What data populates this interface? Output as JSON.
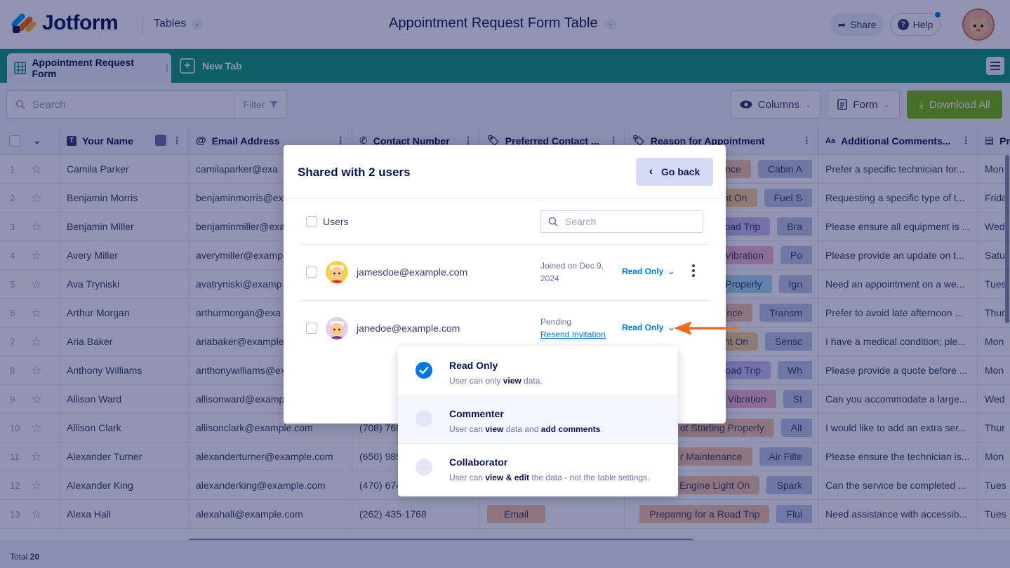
{
  "header": {
    "logo_text": "Jotform",
    "tables_label": "Tables",
    "page_title": "Appointment Request Form Table",
    "share_label": "Share",
    "help_label": "Help"
  },
  "tabs": {
    "active_label": "Appointment Request Form",
    "new_tab_label": "New Tab"
  },
  "toolbar": {
    "search_placeholder": "Search",
    "filter_label": "Filter",
    "columns_label": "Columns",
    "form_label": "Form",
    "download_label": "Download All"
  },
  "table": {
    "headers": [
      "Your Name",
      "Email Address",
      "Contact Number",
      "Preferred Contact ...",
      "Reason for Appointment",
      "Additional Comments...",
      "Pr"
    ],
    "rows": [
      {
        "n": "1",
        "name": "Camila Parker",
        "email": "camilaparker@exa",
        "contact": "",
        "pref": "",
        "reason1": "nce",
        "reason2": "Cabin A",
        "comment": "Prefer a specific technician for...",
        "day": "Mon"
      },
      {
        "n": "2",
        "name": "Benjamin Morris",
        "email": "benjaminmorris@ex",
        "contact": "",
        "pref": "",
        "reason1": "ht On",
        "reason2": "Fuel S",
        "comment": "Requesting a specific type of t...",
        "day": "Frida"
      },
      {
        "n": "3",
        "name": "Benjamin Miller",
        "email": "benjaminmiller@exa",
        "contact": "",
        "pref": "",
        "reason1": "oad Trip",
        "reason2": "Bra",
        "comment": "Please ensure all equipment is ...",
        "day": "Wed"
      },
      {
        "n": "4",
        "name": "Avery Miller",
        "email": "averymiller@example",
        "contact": "",
        "pref": "",
        "reason1": "Vibration",
        "reason2": "Po",
        "comment": "Please provide an update on t...",
        "day": "Satu"
      },
      {
        "n": "5",
        "name": "Ava Tryniski",
        "email": "avatryniski@examp",
        "contact": "",
        "pref": "",
        "reason1": "Properly",
        "reason2": "Ign",
        "comment": "Need an appointment on a we...",
        "day": "Tues"
      },
      {
        "n": "6",
        "name": "Arthur Morgan",
        "email": "arthurmorgan@exa",
        "contact": "",
        "pref": "",
        "reason1": "nce",
        "reason2": "Transm",
        "comment": "Prefer to avoid late afternoon ...",
        "day": "Thur"
      },
      {
        "n": "7",
        "name": "Aria Baker",
        "email": "ariabaker@example.",
        "contact": "",
        "pref": "",
        "reason1": "ht On",
        "reason2": "Sensc",
        "comment": "I have a medical condition; ple...",
        "day": "Mon"
      },
      {
        "n": "8",
        "name": "Anthony Williams",
        "email": "anthonywilliams@ex",
        "contact": "",
        "pref": "",
        "reason1": "oad Trip",
        "reason2": "Wh",
        "comment": "Please provide a quote before ...",
        "day": "Mon"
      },
      {
        "n": "9",
        "name": "Allison Ward",
        "email": "allisonward@examp",
        "contact": "",
        "pref": "",
        "reason1": "Vibration",
        "reason2": "St",
        "comment": "Can you accommodate a large...",
        "day": "Wed"
      },
      {
        "n": "10",
        "name": "Allison Clark",
        "email": "allisonclark@example.com",
        "contact": "(708) 768",
        "pref": "",
        "reason1": "ot Starting Properly",
        "reason2": "Alt",
        "comment": "I would like to add an extra ser...",
        "day": "Thur"
      },
      {
        "n": "11",
        "name": "Alexander Turner",
        "email": "alexanderturner@example.com",
        "contact": "(650) 985",
        "pref": "",
        "reason1": "r Maintenance",
        "reason2": "Air Filte",
        "comment": "Please ensure the technician is...",
        "day": "Mon"
      },
      {
        "n": "12",
        "name": "Alexander King",
        "email": "alexanderking@example.com",
        "contact": "(470) 674",
        "pref": "",
        "reason1": "Engine Light On",
        "reason2": "Spark",
        "comment": "Can the service be completed ...",
        "day": "Tues"
      },
      {
        "n": "13",
        "name": "Alexa Hall",
        "email": "alexahall@example.com",
        "contact": "(262) 435-1768",
        "pref": "Email",
        "reason1": "Preparing for a Road Trip",
        "reason2": "Flui",
        "comment": "Need assistance with accessib...",
        "day": "Tues"
      }
    ],
    "total_label": "Total",
    "total_value": "20"
  },
  "modal": {
    "title": "Shared with 2 users",
    "go_back_label": "Go back",
    "users_label": "Users",
    "search_placeholder": "Search",
    "users": [
      {
        "email": "jamesdoe@example.com",
        "status_line1": "Joined on Dec 9,",
        "status_line2": "2024",
        "role": "Read Only"
      },
      {
        "email": "janedoe@example.com",
        "status_line1": "Pending",
        "status_link": "Resend Invitation",
        "role": "Read Only"
      }
    ]
  },
  "role_dropdown": {
    "options": [
      {
        "title": "Read Only",
        "desc_pre": "User can only ",
        "desc_b1": "view",
        "desc_mid": " data.",
        "desc_b2": "",
        "desc_post": "",
        "selected": true
      },
      {
        "title": "Commenter",
        "desc_pre": "User can ",
        "desc_b1": "view",
        "desc_mid": " data and ",
        "desc_b2": "add comments",
        "desc_post": ".",
        "selected": false
      },
      {
        "title": "Collaborator",
        "desc_pre": "User can ",
        "desc_b1": "view & edit",
        "desc_mid": " the data - not the table settings.",
        "desc_b2": "",
        "desc_post": "",
        "selected": false
      }
    ]
  },
  "colors": {
    "brand_green": "#0f9d74",
    "download_green": "#78bb07",
    "accent_blue": "#0075e3",
    "arrow_orange": "#f26a1b"
  }
}
